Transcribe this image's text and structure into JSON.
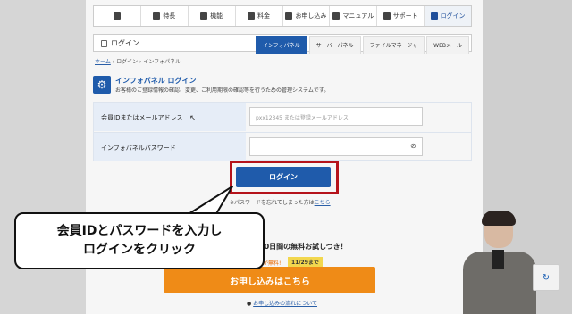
{
  "topnav": {
    "items": [
      {
        "label": "",
        "icon": "home-icon"
      },
      {
        "label": "特長",
        "icon": "monitor-icon"
      },
      {
        "label": "機能",
        "icon": "tools-icon"
      },
      {
        "label": "料金",
        "icon": "tag-icon"
      },
      {
        "label": "お申し込み",
        "icon": "pen-icon"
      },
      {
        "label": "マニュアル",
        "icon": "book-icon"
      },
      {
        "label": "サポート",
        "icon": "user-icon"
      },
      {
        "label": "ログイン",
        "icon": "lock-icon"
      }
    ]
  },
  "titlebar": {
    "title": "ログイン",
    "tabs": [
      "インフォパネル",
      "サーバーパネル",
      "ファイルマネージャ",
      "WEBメール"
    ]
  },
  "breadcrumb": {
    "home": "ホーム",
    "sep": "›",
    "login": "ログイン",
    "current": "インフォパネル"
  },
  "info": {
    "title": "インフォパネル ログイン",
    "subtitle": "お客様のご登録情報の確認、変更、ご利用期限の確認等を行うための管理システムです。"
  },
  "form": {
    "id_label": "会員IDまたはメールアドレス",
    "id_placeholder": "pxx12345 または登録メールアドレス",
    "pw_label": "インフォパネルパスワード"
  },
  "login_button": "ログイン",
  "forgot": {
    "text": "※パスワードを忘れてしまった方は",
    "link": "こちら"
  },
  "bubble": {
    "line1": "会員IDとパスワードを入力し",
    "line2": "ログインをクリック"
  },
  "promo": {
    "trial": "10日間の無料お試しつき！",
    "free_prefix": "が無料!",
    "date": "11/29まで",
    "apply": "お申し込みはこちら",
    "flow_link": "お申し込みの流れについて"
  },
  "colors": {
    "accent": "#1f5bab",
    "highlight": "#b5131b",
    "cta": "#ef8b17"
  }
}
